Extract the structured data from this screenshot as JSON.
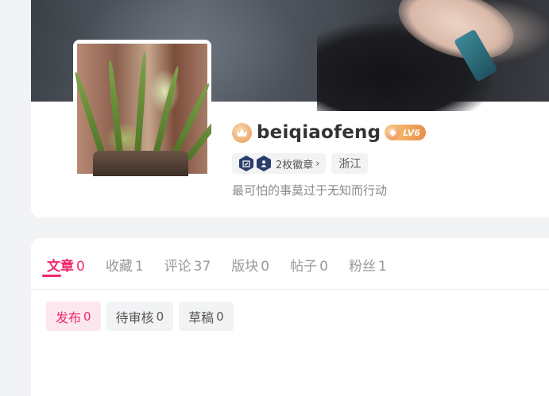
{
  "profile": {
    "username": "beiqiaofeng",
    "level": "LV6",
    "badges": "2枚徽章",
    "region": "浙江",
    "bio": "最可怕的事莫过于无知而行动"
  },
  "tabs": [
    {
      "label": "文章",
      "count": "0"
    },
    {
      "label": "收藏",
      "count": "1"
    },
    {
      "label": "评论",
      "count": "37"
    },
    {
      "label": "版块",
      "count": "0"
    },
    {
      "label": "帖子",
      "count": "0"
    },
    {
      "label": "粉丝",
      "count": "1"
    }
  ],
  "subtabs": [
    {
      "label": "发布",
      "count": "0"
    },
    {
      "label": "待审核",
      "count": "0"
    },
    {
      "label": "草稿",
      "count": "0"
    }
  ],
  "colors": {
    "accent": "#f0276e",
    "accent_soft": "#fde7ee",
    "level_badge": "#e98f49"
  },
  "icons": {
    "crown": "crown-icon",
    "level": "level-gem-icon",
    "badge1": "calendar-check-icon",
    "badge2": "user-icon",
    "chevron": "chevron-right-icon"
  }
}
